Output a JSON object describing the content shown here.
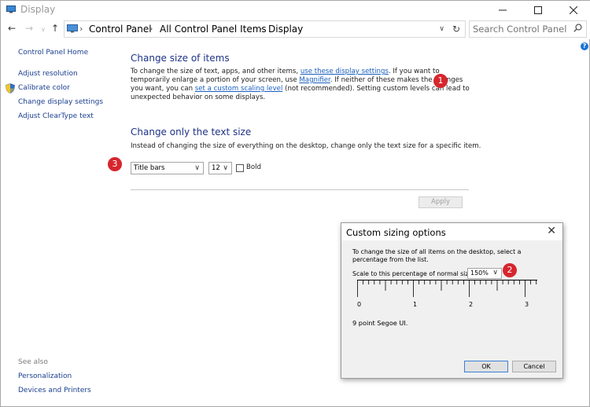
{
  "window": {
    "title": "Display",
    "controls": [
      "minimize",
      "maximize",
      "close"
    ]
  },
  "address_bar": {
    "back_icon": "back-arrow-icon",
    "forward_icon": "forward-arrow-icon",
    "up_icon": "up-arrow-icon",
    "crumbs": [
      "Control Panel",
      "All Control Panel Items",
      "Display"
    ],
    "search_placeholder": "Search Control Panel"
  },
  "sidebar": {
    "home": "Control Panel Home",
    "items": [
      "Adjust resolution",
      "Calibrate color",
      "Change display settings",
      "Adjust ClearType text"
    ],
    "see_also_label": "See also",
    "see_also": [
      "Personalization",
      "Devices and Printers"
    ]
  },
  "section1": {
    "title": "Change size of items",
    "text1": "To change the size of text, apps, and other items, ",
    "link1": "use these display settings",
    "text2": ".  If you want to temporarily enlarge a portion of your screen, use ",
    "link2": "Magnifier",
    "text3": ".  If neither of these makes the changes you want, you can ",
    "link3": "set a custom scaling level",
    "text4": " (not recommended).  Setting custom levels can lead to unexpected behavior on some displays."
  },
  "section2": {
    "title": "Change only the text size",
    "description": "Instead of changing the size of everything on the desktop, change only the text size for a specific item.",
    "item_select": "Title bars",
    "size_select": "12",
    "bold_label": "Bold",
    "bold_checked": false
  },
  "apply_label": "Apply",
  "dialog": {
    "title": "Custom sizing options",
    "description": "To change the size of all items on the desktop, select a percentage from the list.",
    "scale_label": "Scale to this percentage of normal size:",
    "scale_value": "150%",
    "ruler_numbers": [
      "0",
      "1",
      "2",
      "3"
    ],
    "font_sample": "9 point Segoe UI.",
    "ok_label": "OK",
    "cancel_label": "Cancel"
  },
  "markers": [
    "1",
    "2",
    "3"
  ],
  "colors": {
    "link": "#1a5fbf",
    "heading": "#1e3287",
    "marker": "#d6262d"
  }
}
